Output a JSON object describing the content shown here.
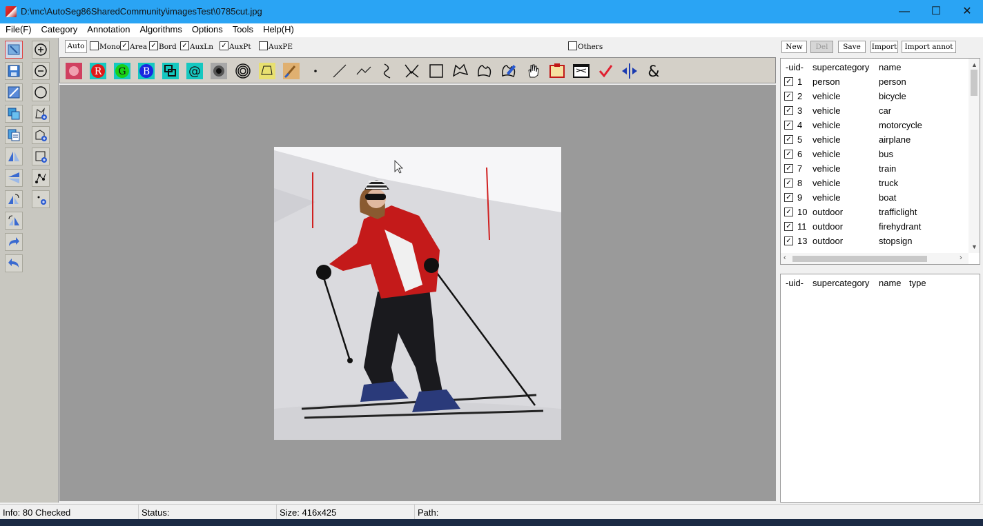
{
  "window": {
    "title": "D:\\mc\\AutoSeg86SharedCommunity\\imagesTest\\0785cut.jpg",
    "minimize": "—",
    "maximize": "☐",
    "close": "✕"
  },
  "menu": [
    "File(F)",
    "Category",
    "Annotation",
    "Algorithms",
    "Options",
    "Tools",
    "Help(H)"
  ],
  "options": {
    "auto": "Auto",
    "mono": {
      "label": "Mono",
      "checked": false
    },
    "area": {
      "label": "Area",
      "checked": true
    },
    "bord": {
      "label": "Bord",
      "checked": true
    },
    "auxln": {
      "label": "AuxLn",
      "checked": true
    },
    "auxpt": {
      "label": "AuxPt",
      "checked": true
    },
    "auxpe": {
      "label": "AuxPE",
      "checked": false
    },
    "others": {
      "label": "Others",
      "checked": false
    }
  },
  "right_buttons": {
    "new": "New",
    "del": "Del",
    "save": "Save",
    "import": "Import",
    "import_annot": "Import annot"
  },
  "category_list": {
    "headers": {
      "uid": "-uid-",
      "supercategory": "supercategory",
      "name": "name"
    },
    "rows": [
      {
        "uid": "1",
        "supercategory": "person",
        "name": "person",
        "checked": true
      },
      {
        "uid": "2",
        "supercategory": "vehicle",
        "name": "bicycle",
        "checked": true
      },
      {
        "uid": "3",
        "supercategory": "vehicle",
        "name": "car",
        "checked": true
      },
      {
        "uid": "4",
        "supercategory": "vehicle",
        "name": "motorcycle",
        "checked": true
      },
      {
        "uid": "5",
        "supercategory": "vehicle",
        "name": "airplane",
        "checked": true
      },
      {
        "uid": "6",
        "supercategory": "vehicle",
        "name": "bus",
        "checked": true
      },
      {
        "uid": "7",
        "supercategory": "vehicle",
        "name": "train",
        "checked": true
      },
      {
        "uid": "8",
        "supercategory": "vehicle",
        "name": "truck",
        "checked": true
      },
      {
        "uid": "9",
        "supercategory": "vehicle",
        "name": "boat",
        "checked": true
      },
      {
        "uid": "10",
        "supercategory": "outdoor",
        "name": "trafficlight",
        "checked": true
      },
      {
        "uid": "11",
        "supercategory": "outdoor",
        "name": "firehydrant",
        "checked": true
      },
      {
        "uid": "13",
        "supercategory": "outdoor",
        "name": "stopsign",
        "checked": true
      }
    ]
  },
  "annotation_list": {
    "headers": {
      "uid": "-uid-",
      "supercategory": "supercategory",
      "name": "name",
      "type": "type"
    }
  },
  "toolbar_text": {
    "r": "R",
    "g": "G",
    "b": "B",
    "at": "@",
    "amp": "&"
  },
  "status": {
    "info": "Info: 80 Checked",
    "status": "Status:",
    "size": "Size: 416x425",
    "path": "Path:"
  }
}
